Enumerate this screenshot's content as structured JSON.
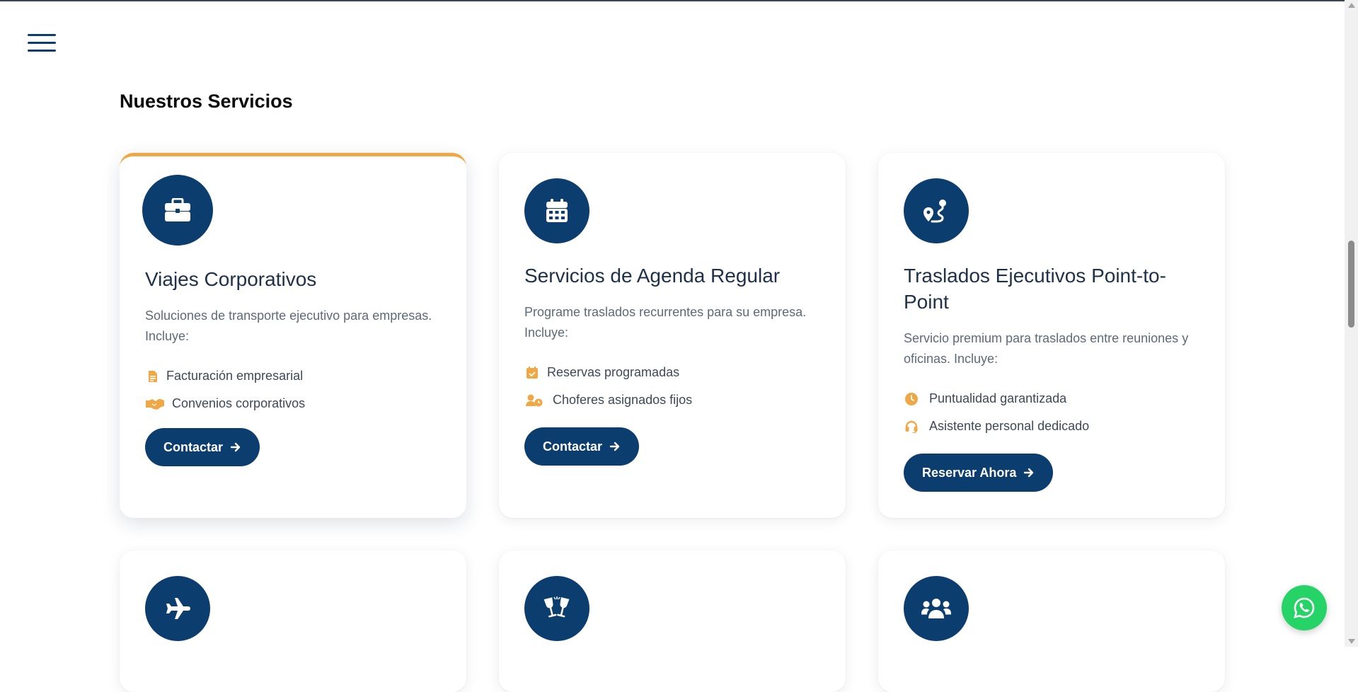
{
  "header": {
    "menu_icon": "hamburger-menu-icon"
  },
  "section": {
    "title": "Nuestros Servicios"
  },
  "colors": {
    "primary": "#0b3d6e",
    "accent": "#f0a846",
    "whatsapp": "#25d366"
  },
  "cards": [
    {
      "icon": "briefcase-icon",
      "title": "Viajes Corporativos",
      "description": "Soluciones de transporte ejecutivo para empresas. Incluye:",
      "features": [
        {
          "icon": "invoice-icon",
          "label": "Facturación empresarial"
        },
        {
          "icon": "handshake-icon",
          "label": "Convenios corporativos"
        }
      ],
      "button": "Contactar"
    },
    {
      "icon": "calendar-icon",
      "title": "Servicios de Agenda Regular",
      "description": "Programe traslados recurrentes para su empresa. Incluye:",
      "features": [
        {
          "icon": "calendar-check-icon",
          "label": "Reservas programadas"
        },
        {
          "icon": "user-clock-icon",
          "label": "Choferes asignados fijos"
        }
      ],
      "button": "Contactar"
    },
    {
      "icon": "route-icon",
      "title": "Traslados Ejecutivos Point-to-Point",
      "description": "Servicio premium para traslados entre reuniones y oficinas. Incluye:",
      "features": [
        {
          "icon": "clock-icon",
          "label": "Puntualidad garantizada"
        },
        {
          "icon": "headset-icon",
          "label": "Asistente personal dedicado"
        }
      ],
      "button": "Reservar Ahora"
    }
  ],
  "second_row_icons": [
    "plane-icon",
    "champagne-glasses-icon",
    "users-icon"
  ],
  "floating": {
    "whatsapp_icon": "whatsapp-icon"
  }
}
